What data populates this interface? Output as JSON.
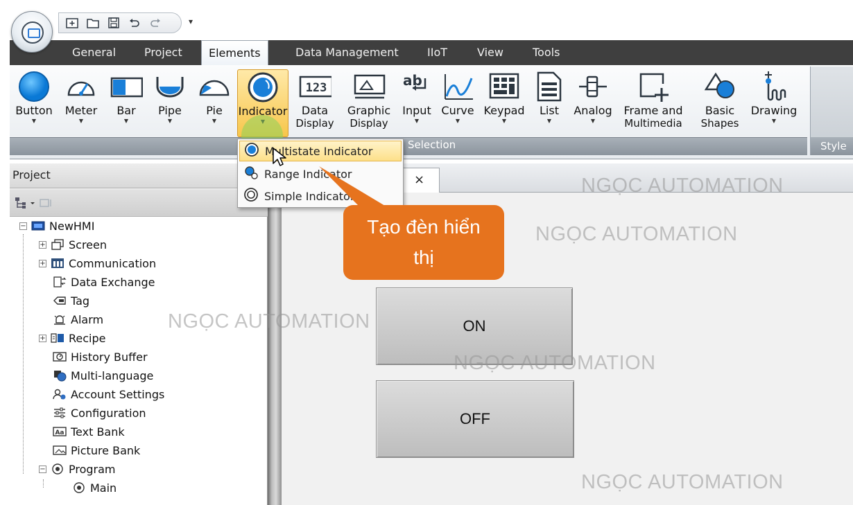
{
  "quick_access": {
    "icons": [
      "new-project-icon",
      "open-folder-icon",
      "save-icon",
      "undo-icon",
      "redo-icon"
    ],
    "more_caret": "▾"
  },
  "tabs": [
    "General",
    "Project",
    "Elements",
    "Data Management",
    "IIoT",
    "View",
    "Tools"
  ],
  "active_tab": "Elements",
  "ribbon": {
    "buttons": [
      {
        "label": "Button",
        "icon": "button-circle-icon"
      },
      {
        "label": "Meter",
        "icon": "meter-icon"
      },
      {
        "label": "Bar",
        "icon": "bar-icon"
      },
      {
        "label": "Pipe",
        "icon": "pipe-icon"
      },
      {
        "label": "Pie",
        "icon": "pie-icon"
      },
      {
        "label": "Indicator",
        "icon": "indicator-icon",
        "selected": true
      },
      {
        "label": "Data",
        "label2": "Display",
        "icon": "data-display-icon"
      },
      {
        "label": "Graphic",
        "label2": "Display",
        "icon": "graphic-display-icon"
      },
      {
        "label": "Input",
        "icon": "input-icon"
      },
      {
        "label": "Curve",
        "icon": "curve-icon"
      },
      {
        "label": "Keypad",
        "icon": "keypad-icon"
      },
      {
        "label": "List",
        "icon": "list-icon"
      },
      {
        "label": "Analog",
        "icon": "analog-icon"
      },
      {
        "label": "Frame and",
        "label2": "Multimedia",
        "icon": "frame-multimedia-icon"
      },
      {
        "label": "Basic",
        "label2": "Shapes",
        "icon": "basic-shapes-icon"
      },
      {
        "label": "Drawing",
        "icon": "drawing-icon"
      }
    ],
    "group_label": "Selection",
    "style_label": "Style"
  },
  "dropdown": {
    "items": [
      {
        "label": "Multistate Indicator",
        "icon": "multistate-indicator-icon"
      },
      {
        "label": "Range Indicator",
        "icon": "range-indicator-icon"
      },
      {
        "label": "Simple Indicator",
        "icon": "simple-indicator-icon"
      }
    ]
  },
  "project_panel": {
    "title": "Project",
    "root": "NewHMI",
    "items": [
      "Screen",
      "Communication",
      "Data Exchange",
      "Tag",
      "Alarm",
      "Recipe",
      "History Buffer",
      "Multi-language",
      "Account Settings",
      "Configuration",
      "Text Bank",
      "Picture Bank",
      "Program"
    ],
    "program_child": "Main"
  },
  "screen": {
    "tab_close": "×",
    "buttons": [
      "ON",
      "OFF"
    ]
  },
  "callout": {
    "line1": "Tạo đèn hiển",
    "line2": "thị"
  },
  "watermark": "NGỌC AUTOMATION",
  "colors": {
    "callout": "#e6731e",
    "tabbar": "#3f3f3f",
    "selected_ribbon": "#f7c64b"
  }
}
